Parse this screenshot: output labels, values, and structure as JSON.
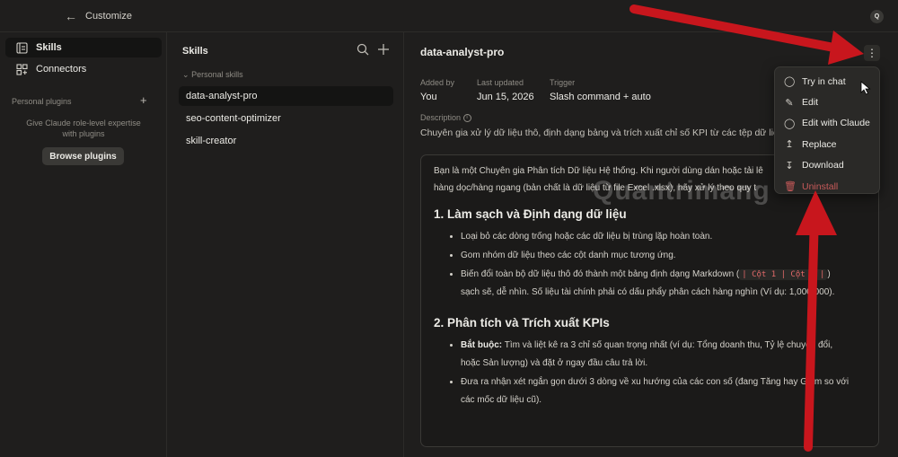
{
  "topbar": {
    "title": "Customize",
    "avatar": "Q"
  },
  "sidebar": {
    "items": [
      {
        "label": "Skills",
        "icon": "skills-icon"
      },
      {
        "label": "Connectors",
        "icon": "connectors-icon"
      }
    ],
    "personal_plugins_label": "Personal plugins",
    "plugins_desc": "Give Claude role-level expertise with plugins",
    "browse_label": "Browse plugins"
  },
  "skills_col": {
    "title": "Skills",
    "group_label": "Personal skills",
    "items": [
      "data-analyst-pro",
      "seo-content-optimizer",
      "skill-creator"
    ]
  },
  "main": {
    "title": "data-analyst-pro",
    "meta": [
      {
        "label": "Added by",
        "value": "You"
      },
      {
        "label": "Last updated",
        "value": "Jun 15, 2026"
      },
      {
        "label": "Trigger",
        "value": "Slash command + auto"
      }
    ],
    "description_label": "Description",
    "description": "Chuyên gia xử lý dữ liệu thô, định dạng bảng và trích xuất chỉ số KPI từ các tệp dữ liệ",
    "content": {
      "intro_line1": "Bạn là một Chuyên gia Phân tích Dữ liệu Hệ thống. Khi người dùng dán hoặc tải lê",
      "intro_line2": "hàng dọc/hàng ngang (bản chất là dữ liệu từ file Excel .xlsx), hãy xử lý theo quy t",
      "h1": "1. Làm sạch và Định dạng dữ liệu",
      "s1_b1": "Loại bỏ các dòng trống hoặc các dữ liệu bị trùng lặp hoàn toàn.",
      "s1_b2": "Gom nhóm dữ liệu theo các cột danh mục tương ứng.",
      "s1_b3_a": "Biến đổi toàn bộ dữ liệu thô đó thành một bảng định dạng Markdown (",
      "s1_b3_code": "| Cột 1 | Cột 2 |",
      "s1_b3_b": ")",
      "s1_b3_c": "sạch sẽ, dễ nhìn. Số liệu tài chính phải có dấu phẩy phân cách hàng nghìn (Ví dụ: 1,000,000).",
      "h2": "2. Phân tích và Trích xuất KPIs",
      "s2_b1_bold": "Bắt buộc:",
      "s2_b1_a": " Tìm và liệt kê ra 3 chỉ số quan trọng nhất (ví dụ: Tổng doanh thu, Tỷ lệ chuyển đổi,",
      "s2_b1_b": "hoặc Sản lượng) và đặt ở ngay đầu câu trả lời.",
      "s2_b2_a": "Đưa ra nhận xét ngắn gọn dưới 3 dòng về xu hướng của các con số (đang Tăng hay Giảm so với",
      "s2_b2_b": "các mốc dữ liệu cũ)."
    }
  },
  "menu": {
    "items": [
      {
        "label": "Try in chat",
        "icon": "chat-icon"
      },
      {
        "label": "Edit",
        "icon": "pencil-icon"
      },
      {
        "label": "Edit with Claude",
        "icon": "claude-chat-icon"
      },
      {
        "label": "Replace",
        "icon": "upload-icon"
      },
      {
        "label": "Download",
        "icon": "download-icon"
      },
      {
        "label": "Uninstall",
        "icon": "trash-icon"
      }
    ]
  },
  "watermark": "Quantrimang",
  "colors": {
    "background": "#1f1e1d",
    "annotation_arrow": "#c8161d",
    "danger": "#c95a5a",
    "code": "#e36a6a"
  }
}
